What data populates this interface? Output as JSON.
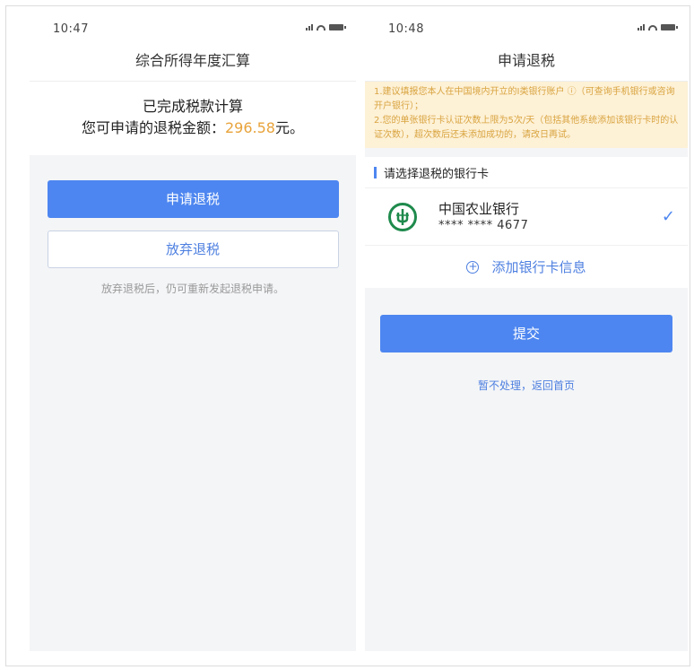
{
  "left": {
    "status_time": "10:47",
    "title": "综合所得年度汇算",
    "result_title": "已完成税款计算",
    "refund_label": "您可申请的退税金额：",
    "refund_amount": "296.58",
    "refund_unit": "元。",
    "apply_button": "申请退税",
    "abandon_button": "放弃退税",
    "hint": "放弃退税后，仍可重新发起退税申请。"
  },
  "right": {
    "status_time": "10:48",
    "title": "申请退税",
    "notice_line1": "1.建议填报您本人在中国境内开立的Ⅰ类银行账户 ⓘ（可查询手机银行或咨询开户银行）；",
    "notice_line2": "2.您的单张银行卡认证次数上限为5次/天（包括其他系统添加该银行卡时的认证次数），超次数后还未添加成功的，请改日再试。",
    "section_title": "请选择退税的银行卡",
    "bank": {
      "name": "中国农业银行",
      "number": "**** **** 4677",
      "icon": "abc-bank-logo",
      "selected": true
    },
    "add_card": "添加银行卡信息",
    "submit_button": "提交",
    "home_link": "暂不处理，返回首页"
  },
  "colors": {
    "primary": "#4d86f0",
    "amount": "#e8a33b",
    "notice_bg": "#fdf1d6",
    "notice_text": "#d9a440",
    "bank_green": "#1e8a4c"
  }
}
